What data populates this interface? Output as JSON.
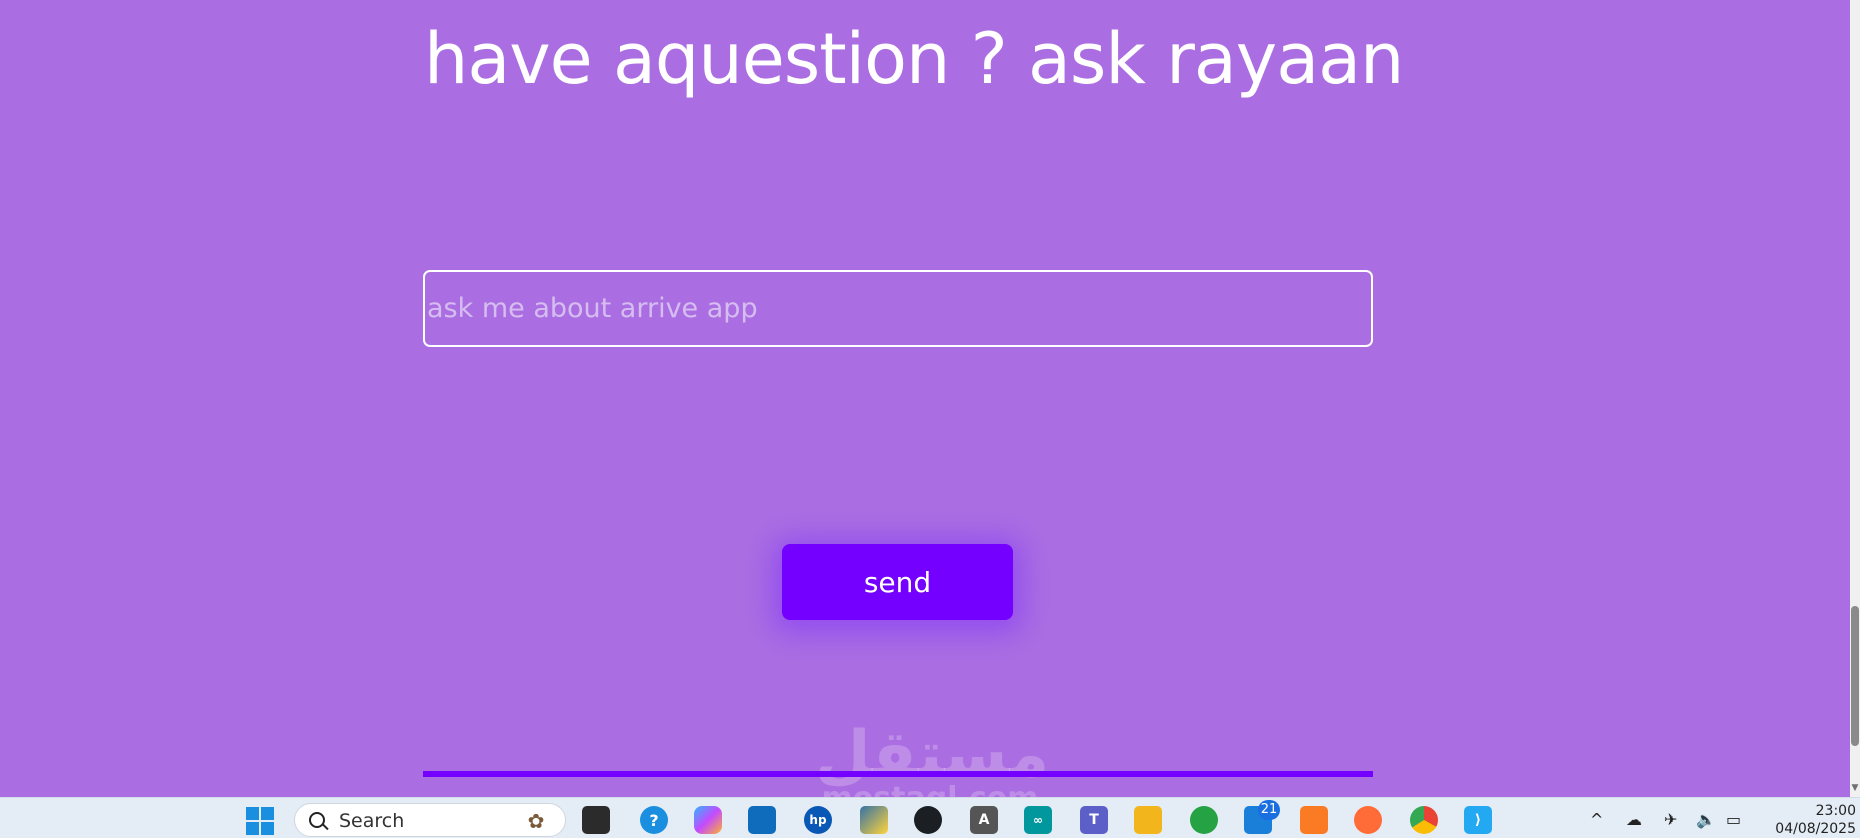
{
  "page": {
    "title": "have aquestion ? ask rayaan",
    "input_placeholder": "ask me about arrive app",
    "send_label": "send"
  },
  "watermark": {
    "arabic": "مستقل",
    "latin": "mostaql.com"
  },
  "taskbar": {
    "search_label": "Search",
    "icons": [
      "windows-start-icon",
      "task-view-icon",
      "weather-widget-icon",
      "copilot-icon",
      "microsoft-store-icon",
      "hp-icon",
      "python-icon",
      "github-icon",
      "font-app-icon",
      "arduino-icon",
      "teams-icon",
      "file-explorer-icon",
      "whatsapp-icon",
      "remote-desktop-icon",
      "xampp-icon",
      "postman-icon",
      "chrome-icon",
      "vscode-icon"
    ],
    "notification_badge": "21",
    "tray": {
      "chevron": "^",
      "icons": [
        "onedrive-icon",
        "airplane-mode-icon",
        "volume-icon",
        "battery-icon"
      ]
    },
    "clock": {
      "time": "23:00",
      "date": "04/08/2025"
    }
  },
  "colors": {
    "background": "#ab6ee2",
    "accent": "#7400ff",
    "text": "#ffffff"
  }
}
